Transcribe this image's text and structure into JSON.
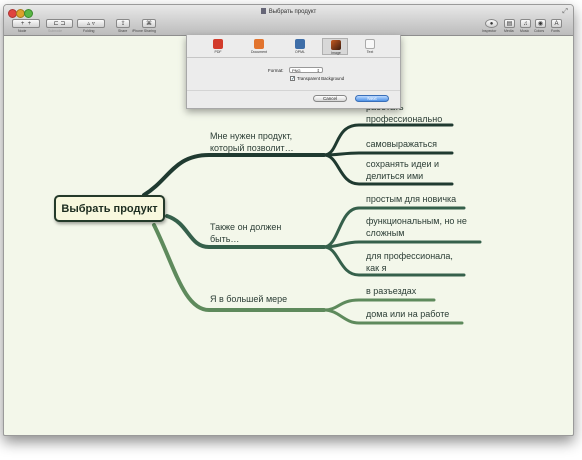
{
  "window": {
    "title": "Выбрать продукт"
  },
  "toolbar": {
    "left": [
      {
        "label": "Node",
        "icon": "add-node-icon"
      },
      {
        "label": "Subnode",
        "icon": "add-subnode-icon"
      },
      {
        "label": "Folding",
        "icon": "folding-icon"
      },
      {
        "label": "Share",
        "icon": "share-icon"
      },
      {
        "label": "iPhone Sharing",
        "icon": "iphone-sharing-icon"
      }
    ],
    "right": [
      {
        "label": "Inspector",
        "icon": "inspector-icon"
      },
      {
        "label": "Media",
        "icon": "media-icon"
      },
      {
        "label": "Music",
        "icon": "music-icon"
      },
      {
        "label": "Colors",
        "icon": "colors-icon"
      },
      {
        "label": "Fonts",
        "icon": "fonts-icon"
      }
    ]
  },
  "export_sheet": {
    "tabs": [
      {
        "label": "PDF",
        "icon": "pdf-icon",
        "color": "#d23b2b"
      },
      {
        "label": "Document",
        "icon": "document-icon",
        "color": "#e2742e"
      },
      {
        "label": "OPML",
        "icon": "opml-icon",
        "color": "#3e6ea8"
      },
      {
        "label": "Image",
        "icon": "image-icon",
        "color": "#7d3a1f",
        "active": true
      },
      {
        "label": "Text",
        "icon": "text-icon",
        "color": "#e8e8e8"
      }
    ],
    "format_label": "Format:",
    "format_value": "PNG",
    "transparent_background": {
      "label": "Transparent Background",
      "checked": true
    },
    "cancel_label": "Cancel",
    "next_label": "Next"
  },
  "mindmap": {
    "root": "Выбрать продукт",
    "branches": [
      {
        "text": [
          "Мне нужен продукт,",
          "который позволит…"
        ],
        "color": "#1f3a30",
        "children": [
          [
            "работать",
            "профессионально"
          ],
          [
            "самовыражаться"
          ],
          [
            "сохранять идеи и",
            "делиться ими"
          ]
        ]
      },
      {
        "text": [
          "Также он должен",
          "быть…"
        ],
        "color": "#35604b",
        "children": [
          [
            "простым для новичка"
          ],
          [
            "функциональным, но не",
            "сложным"
          ],
          [
            "для профессионала,",
            "как я"
          ]
        ]
      },
      {
        "text": [
          "Я в большей мере"
        ],
        "color": "#5e8a5c",
        "children": [
          [
            "в разъездах"
          ],
          [
            "дома или на работе"
          ]
        ]
      }
    ]
  }
}
